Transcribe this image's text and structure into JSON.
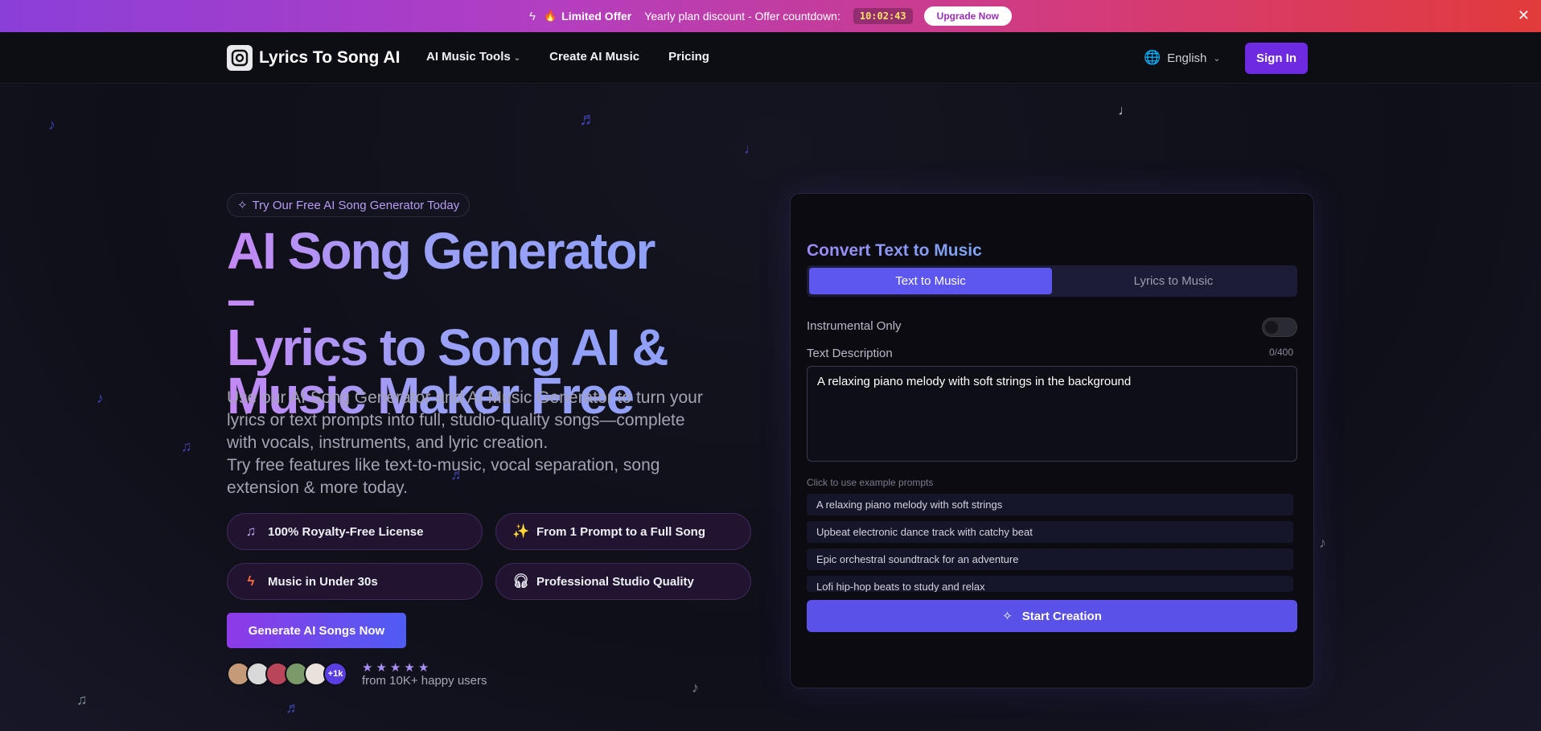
{
  "banner": {
    "offer": "Limited Offer",
    "discount": "Yearly plan discount - Offer countdown:",
    "countdown": "10:02:43",
    "upgrade": "Upgrade Now",
    "close": "✕"
  },
  "nav": {
    "brand": "Lyrics To Song AI",
    "links": [
      "AI Music Tools",
      "Create AI Music",
      "Pricing"
    ],
    "language": "English",
    "signin": "Sign In"
  },
  "hero": {
    "pill": "Try Our Free AI Song Generator Today",
    "headline": [
      "AI Song Generator –",
      "Lyrics to Song AI &",
      "Music Maker Free"
    ],
    "subtext": [
      "Use our AI Song Generator and AI Music Generator to turn your",
      "lyrics or text prompts into full, studio-quality songs—complete",
      "with vocals, instruments, and lyric creation.",
      "Try free features like text-to-music, vocal separation, song",
      "extension & more today."
    ],
    "features": [
      {
        "label": "100% Royalty-Free License",
        "icon": "music-note-icon"
      },
      {
        "label": "From 1 Prompt to a Full Song",
        "icon": "sparkles-icon"
      },
      {
        "label": "Music in Under 30s",
        "icon": "lightning-icon"
      },
      {
        "label": "Professional Studio Quality",
        "icon": "headphones-icon"
      }
    ],
    "cta": "Generate AI Songs Now",
    "avatars_more": "+1k",
    "rating_stars": 5,
    "happy_users": "from 10K+ happy users"
  },
  "card": {
    "title": "Convert Text to Music",
    "tabs": [
      "Text to Music",
      "Lyrics to Music"
    ],
    "instrumental_label": "Instrumental Only",
    "instrumental_on": false,
    "description_label": "Text Description",
    "counter": "0/400",
    "description_value": "A relaxing piano melody with soft strings in the background",
    "examples_hint": "Click to use example prompts",
    "examples": [
      "A relaxing piano melody with soft strings",
      "Upbeat electronic dance track with catchy beat",
      "Epic orchestral soundtrack for an adventure",
      "Lofi hip-hop beats to study and relax"
    ],
    "start": "Start Creation"
  },
  "colors": {
    "accent": "#5a52e8",
    "signin": "#6d2ae0",
    "banner_start": "#8b3fd9",
    "banner_end": "#e23b3b"
  }
}
